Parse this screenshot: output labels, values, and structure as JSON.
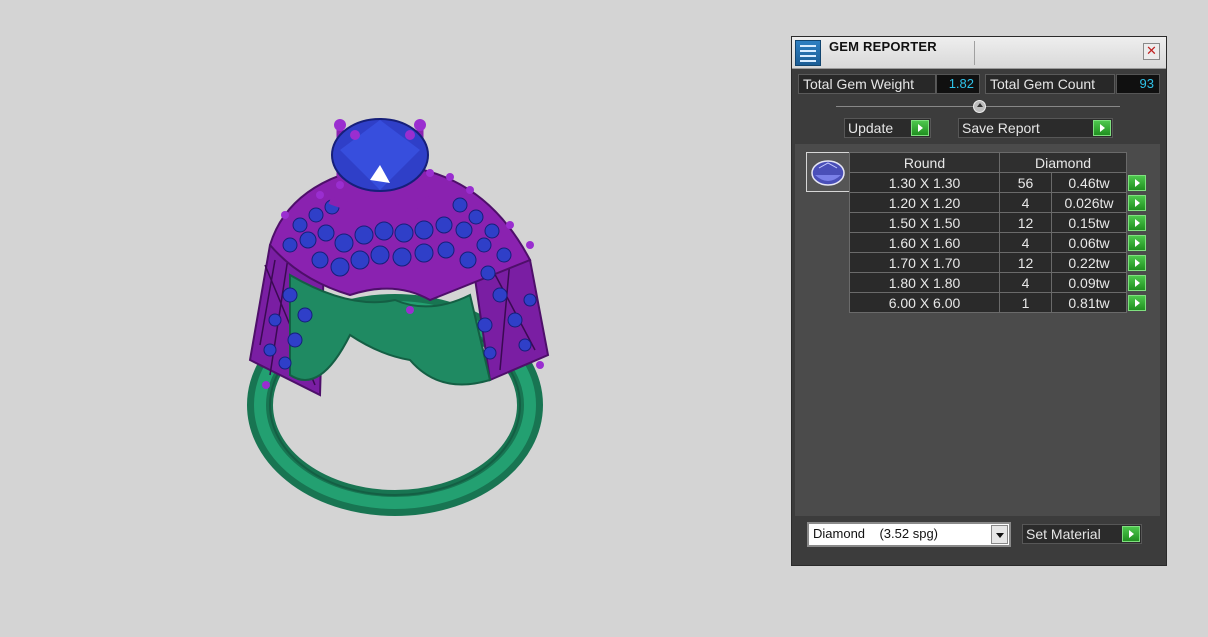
{
  "panel": {
    "title": "GEM REPORTER",
    "icons": {
      "app": "gem-reporter-app-icon",
      "close": "close-icon"
    },
    "total_weight_label": "Total Gem Weight",
    "total_weight_value": "1.82",
    "total_count_label": "Total Gem Count",
    "total_count_value": "93",
    "update_label": "Update",
    "save_report_label": "Save Report",
    "table": {
      "shape_header": "Round",
      "material_header": "Diamond",
      "rows": [
        {
          "size": "1.30 X 1.30",
          "count": "56",
          "weight": "0.46tw"
        },
        {
          "size": "1.20 X 1.20",
          "count": "4",
          "weight": "0.026tw"
        },
        {
          "size": "1.50 X 1.50",
          "count": "12",
          "weight": "0.15tw"
        },
        {
          "size": "1.60 X 1.60",
          "count": "4",
          "weight": "0.06tw"
        },
        {
          "size": "1.70 X 1.70",
          "count": "12",
          "weight": "0.22tw"
        },
        {
          "size": "1.80 X 1.80",
          "count": "4",
          "weight": "0.09tw"
        },
        {
          "size": "6.00 X 6.00",
          "count": "1",
          "weight": "0.81tw"
        }
      ]
    },
    "material_select_value": "Diamond    (3.52 spg)",
    "set_material_label": "Set Material"
  },
  "colors": {
    "metal_green": "#1f8a62",
    "prong_purple": "#8a22b0",
    "gem_blue": "#2f3fc8",
    "readout_cyan": "#2fc2e8",
    "go_green": "#2aa22a"
  }
}
